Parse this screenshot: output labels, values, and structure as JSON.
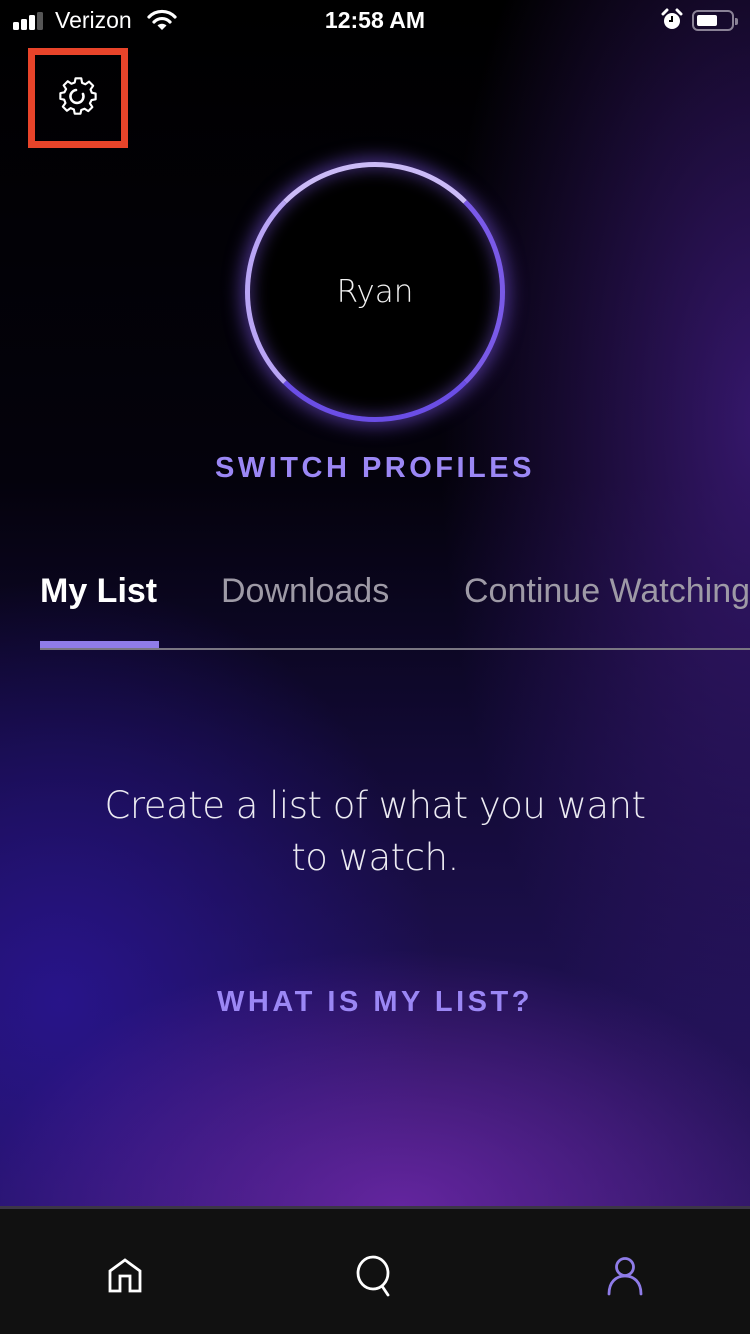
{
  "status_bar": {
    "carrier": "Verizon",
    "time": "12:58 AM",
    "signal_bars": 3,
    "signal_bars_total": 4,
    "icons": [
      "signal-icon",
      "wifi-icon",
      "alarm-icon",
      "battery-icon"
    ]
  },
  "header": {
    "settings_icon": "gear-icon",
    "highlight_color": "#e8442a"
  },
  "profile": {
    "name": "Ryan",
    "switch_label": "SWITCH PROFILES"
  },
  "tabs": [
    {
      "label": "My List",
      "active": true
    },
    {
      "label": "Downloads",
      "active": false
    },
    {
      "label": "Continue Watching",
      "active": false
    }
  ],
  "content": {
    "empty_message": "Create a list of what you want to watch.",
    "help_link": "WHAT IS MY LIST?"
  },
  "bottom_nav": [
    {
      "name": "home",
      "icon": "home-icon",
      "active": false
    },
    {
      "name": "search",
      "icon": "search-icon",
      "active": false
    },
    {
      "name": "profile",
      "icon": "profile-icon",
      "active": true
    }
  ],
  "colors": {
    "accent": "#9b87f5",
    "nav_active": "#8f7ce8",
    "text_inactive": "#9e9aa6"
  }
}
